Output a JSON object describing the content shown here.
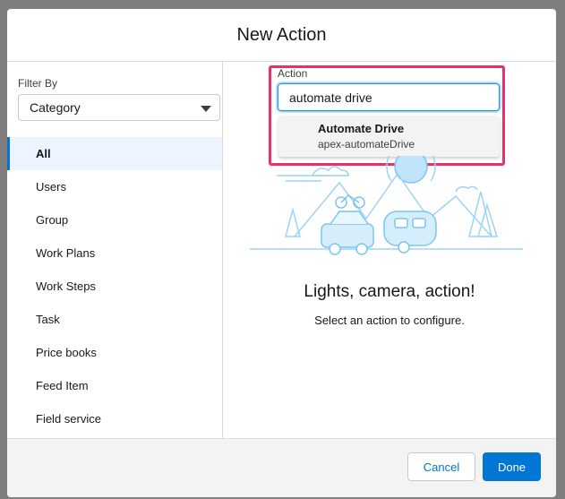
{
  "modal": {
    "title": "New Action"
  },
  "filter": {
    "label": "Filter By",
    "selected": "Category"
  },
  "categories": [
    {
      "label": "All"
    },
    {
      "label": "Users"
    },
    {
      "label": "Group"
    },
    {
      "label": "Work Plans"
    },
    {
      "label": "Work Steps"
    },
    {
      "label": "Task"
    },
    {
      "label": "Price books"
    },
    {
      "label": "Feed Item"
    },
    {
      "label": "Field service"
    }
  ],
  "action": {
    "label": "Action",
    "value": "automate drive",
    "results": [
      {
        "title": "Automate Drive",
        "subtitle": "apex-automateDrive"
      }
    ]
  },
  "empty_state": {
    "headline": "Lights, camera, action!",
    "subline": "Select an action to configure."
  },
  "footer": {
    "cancel": "Cancel",
    "done": "Done"
  },
  "colors": {
    "brand": "#0176d3",
    "highlight": "#e8316b"
  }
}
